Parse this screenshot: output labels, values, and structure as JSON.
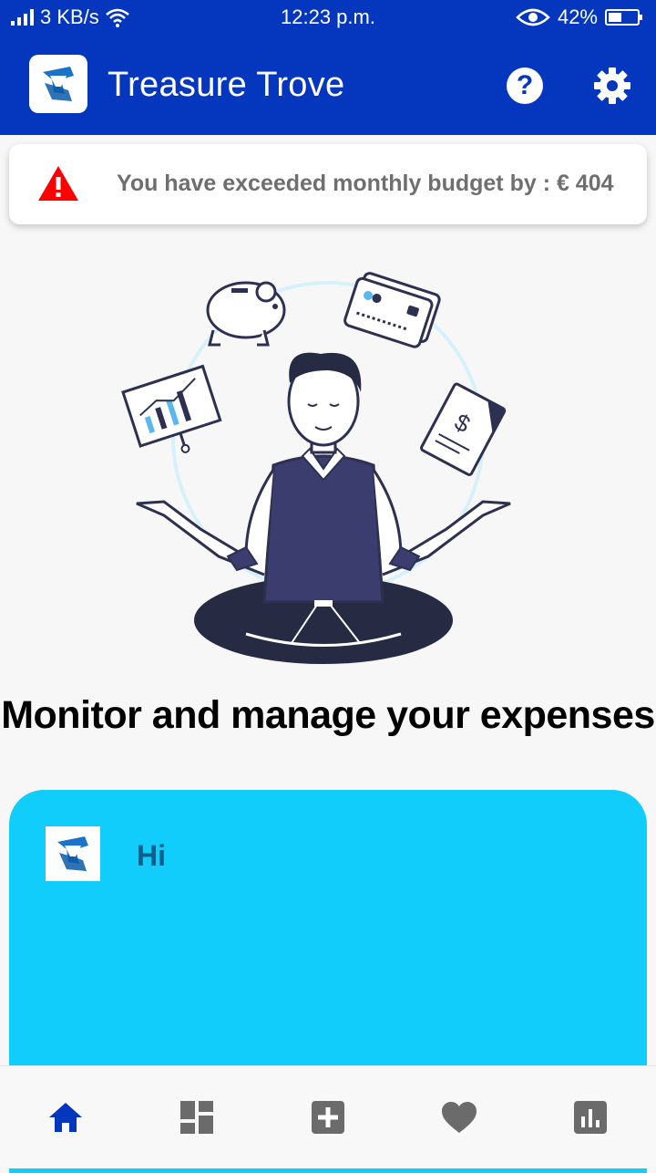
{
  "status_bar": {
    "network_speed": "3 KB/s",
    "time": "12:23 p.m.",
    "battery": "42%",
    "icons": [
      "signal-icon",
      "wifi-icon",
      "eye-icon",
      "battery-icon"
    ]
  },
  "app_bar": {
    "title": "Treasure Trove",
    "help_label": "?",
    "colors": {
      "primary": "#0437bd",
      "on_primary": "#ffffff"
    }
  },
  "alert": {
    "message": "You have exceeded monthly budget by : € 404",
    "icon": "warning-icon",
    "color": "#ff0000"
  },
  "hero": {
    "headline": "Monitor and manage your expenses"
  },
  "greeting_card": {
    "text": "Hi",
    "color": "#10cdfc"
  },
  "bottom_nav": {
    "items": [
      {
        "icon": "home-icon",
        "active": true
      },
      {
        "icon": "dashboard-icon",
        "active": false
      },
      {
        "icon": "add-icon",
        "active": false
      },
      {
        "icon": "heart-icon",
        "active": false
      },
      {
        "icon": "chart-icon",
        "active": false
      }
    ],
    "active_color": "#0437bd",
    "inactive_color": "#6b6b6b"
  }
}
